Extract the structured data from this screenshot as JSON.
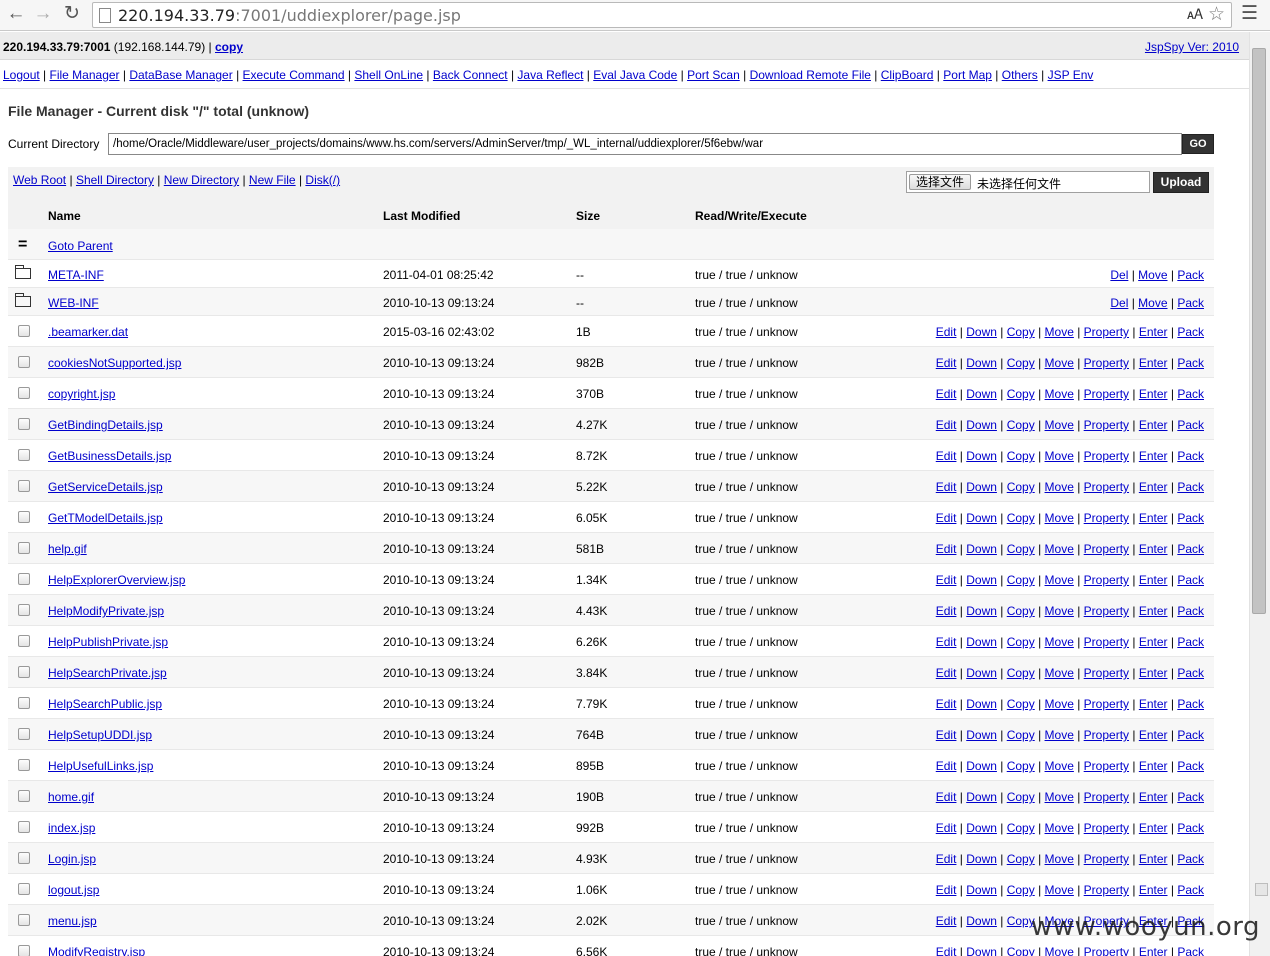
{
  "browser": {
    "url_host": "220.194.33.79",
    "url_rest": ":7001/uddiexplorer/page.jsp",
    "icons": [
      "back-icon",
      "forward-icon",
      "reload-icon",
      "page-icon",
      "translate-icon",
      "star-icon",
      "menu-icon"
    ]
  },
  "header": {
    "host": "220.194.33.79:7001",
    "ip": "(192.168.144.79)",
    "sep": "|",
    "copy_label": "copy",
    "version": "JspSpy Ver: 2010"
  },
  "menu": [
    "Logout",
    "File Manager",
    "DataBase Manager",
    "Execute Command",
    "Shell OnLine",
    "Back Connect",
    "Java Reflect",
    "Eval Java Code",
    "Port Scan",
    "Download Remote File",
    "ClipBoard",
    "Port Map",
    "Others",
    "JSP Env"
  ],
  "page_title": "File Manager - Current disk \"/\" total (unknow)",
  "current_dir": {
    "label": "Current Directory",
    "value": "/home/Oracle/Middleware/user_projects/domains/www.hs.com/servers/AdminServer/tmp/_WL_internal/uddiexplorer/5f6ebw/war",
    "go_label": "GO"
  },
  "actions": [
    "Web Root",
    "Shell Directory",
    "New Directory",
    "New File",
    "Disk(/)"
  ],
  "upload": {
    "choose_label": "选择文件",
    "no_file_label": "未选择任何文件",
    "upload_label": "Upload"
  },
  "columns": {
    "name": "Name",
    "modified": "Last Modified",
    "size": "Size",
    "perm": "Read/Write/Execute"
  },
  "parent_label": "Goto Parent",
  "folders": [
    {
      "name": "META-INF",
      "modified": "2011-04-01 08:25:42",
      "size": "--",
      "perm": "true / true / unknow"
    },
    {
      "name": "WEB-INF",
      "modified": "2010-10-13 09:13:24",
      "size": "--",
      "perm": "true / true / unknow"
    }
  ],
  "folder_actions": [
    "Del",
    "Move",
    "Pack"
  ],
  "files": [
    {
      "name": ".beamarker.dat",
      "modified": "2015-03-16 02:43:02",
      "size": "1B",
      "perm": "true / true / unknow"
    },
    {
      "name": "cookiesNotSupported.jsp",
      "modified": "2010-10-13 09:13:24",
      "size": "982B",
      "perm": "true / true / unknow"
    },
    {
      "name": "copyright.jsp",
      "modified": "2010-10-13 09:13:24",
      "size": "370B",
      "perm": "true / true / unknow"
    },
    {
      "name": "GetBindingDetails.jsp",
      "modified": "2010-10-13 09:13:24",
      "size": "4.27K",
      "perm": "true / true / unknow"
    },
    {
      "name": "GetBusinessDetails.jsp",
      "modified": "2010-10-13 09:13:24",
      "size": "8.72K",
      "perm": "true / true / unknow"
    },
    {
      "name": "GetServiceDetails.jsp",
      "modified": "2010-10-13 09:13:24",
      "size": "5.22K",
      "perm": "true / true / unknow"
    },
    {
      "name": "GetTModelDetails.jsp",
      "modified": "2010-10-13 09:13:24",
      "size": "6.05K",
      "perm": "true / true / unknow"
    },
    {
      "name": "help.gif",
      "modified": "2010-10-13 09:13:24",
      "size": "581B",
      "perm": "true / true / unknow"
    },
    {
      "name": "HelpExplorerOverview.jsp",
      "modified": "2010-10-13 09:13:24",
      "size": "1.34K",
      "perm": "true / true / unknow"
    },
    {
      "name": "HelpModifyPrivate.jsp",
      "modified": "2010-10-13 09:13:24",
      "size": "4.43K",
      "perm": "true / true / unknow"
    },
    {
      "name": "HelpPublishPrivate.jsp",
      "modified": "2010-10-13 09:13:24",
      "size": "6.26K",
      "perm": "true / true / unknow"
    },
    {
      "name": "HelpSearchPrivate.jsp",
      "modified": "2010-10-13 09:13:24",
      "size": "3.84K",
      "perm": "true / true / unknow"
    },
    {
      "name": "HelpSearchPublic.jsp",
      "modified": "2010-10-13 09:13:24",
      "size": "7.79K",
      "perm": "true / true / unknow"
    },
    {
      "name": "HelpSetupUDDI.jsp",
      "modified": "2010-10-13 09:13:24",
      "size": "764B",
      "perm": "true / true / unknow"
    },
    {
      "name": "HelpUsefulLinks.jsp",
      "modified": "2010-10-13 09:13:24",
      "size": "895B",
      "perm": "true / true / unknow"
    },
    {
      "name": "home.gif",
      "modified": "2010-10-13 09:13:24",
      "size": "190B",
      "perm": "true / true / unknow"
    },
    {
      "name": "index.jsp",
      "modified": "2010-10-13 09:13:24",
      "size": "992B",
      "perm": "true / true / unknow"
    },
    {
      "name": "Login.jsp",
      "modified": "2010-10-13 09:13:24",
      "size": "4.93K",
      "perm": "true / true / unknow"
    },
    {
      "name": "logout.jsp",
      "modified": "2010-10-13 09:13:24",
      "size": "1.06K",
      "perm": "true / true / unknow"
    },
    {
      "name": "menu.jsp",
      "modified": "2010-10-13 09:13:24",
      "size": "2.02K",
      "perm": "true / true / unknow"
    },
    {
      "name": "ModifyRegistry.jsp",
      "modified": "2010-10-13 09:13:24",
      "size": "6.56K",
      "perm": "true / true / unknow"
    }
  ],
  "file_actions": [
    "Edit",
    "Down",
    "Copy",
    "Move",
    "Property",
    "Enter",
    "Pack"
  ],
  "watermark": "www.wooyun.org"
}
